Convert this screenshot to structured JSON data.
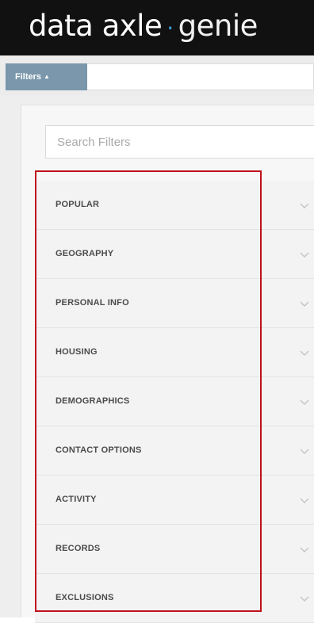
{
  "header": {
    "brand_primary": "data axle",
    "brand_separator": "·",
    "brand_secondary": "genie",
    "colors": {
      "background": "#111111",
      "separator": "#3ca0d8"
    }
  },
  "filterbar": {
    "tab_label": "Filters",
    "tab_icon": "caret-up-icon",
    "tab_color": "#7a97ab"
  },
  "search": {
    "placeholder": "Search Filters",
    "value": ""
  },
  "categories": [
    {
      "label": "POPULAR",
      "icon": "chevron-down-icon"
    },
    {
      "label": "GEOGRAPHY",
      "icon": "chevron-down-icon"
    },
    {
      "label": "PERSONAL INFO",
      "icon": "chevron-down-icon"
    },
    {
      "label": "HOUSING",
      "icon": "chevron-down-icon"
    },
    {
      "label": "DEMOGRAPHICS",
      "icon": "chevron-down-icon"
    },
    {
      "label": "CONTACT OPTIONS",
      "icon": "chevron-down-icon"
    },
    {
      "label": "ACTIVITY",
      "icon": "chevron-down-icon"
    },
    {
      "label": "RECORDS",
      "icon": "chevron-down-icon"
    },
    {
      "label": "EXCLUSIONS",
      "icon": "chevron-down-icon"
    }
  ],
  "highlight": {
    "color": "#c0111a"
  }
}
